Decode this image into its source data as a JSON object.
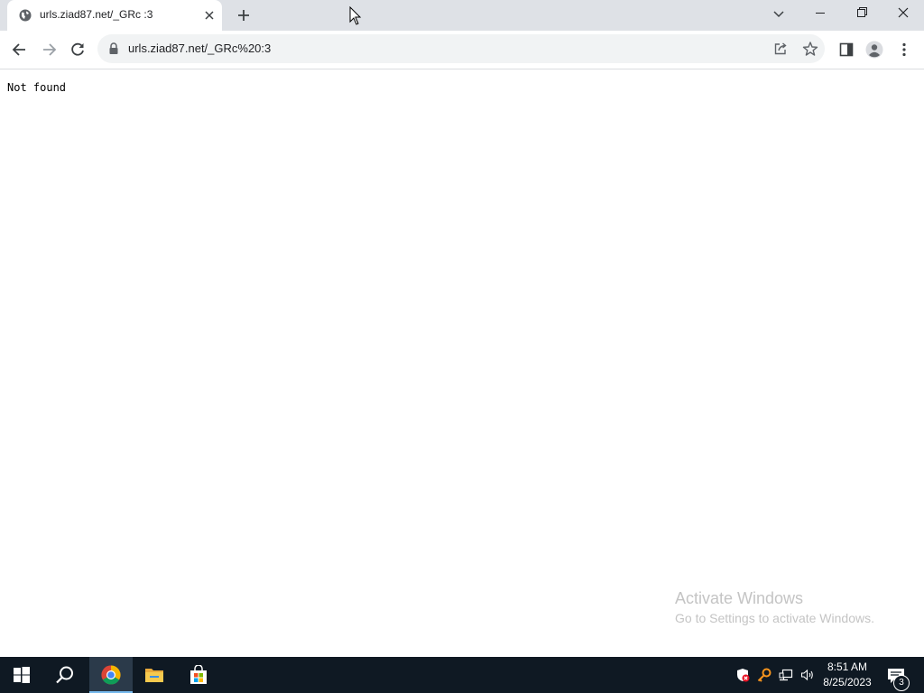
{
  "browser": {
    "tab": {
      "title": "urls.ziad87.net/_GRc :3",
      "favicon": "globe-icon"
    },
    "address_bar": {
      "url": "urls.ziad87.net/_GRc%20:3"
    },
    "icons": {
      "back": "back-arrow-icon",
      "forward": "forward-arrow-icon",
      "reload": "reload-icon",
      "share": "share-icon",
      "bookmark": "star-icon",
      "side_panel": "side-panel-icon",
      "profile": "profile-icon",
      "menu": "kebab-menu-icon"
    }
  },
  "page": {
    "body_text": "Not found"
  },
  "watermark": {
    "title": "Activate Windows",
    "subtitle": "Go to Settings to activate Windows."
  },
  "taskbar": {
    "apps": [
      "start",
      "search",
      "chrome",
      "file-explorer",
      "microsoft-store"
    ],
    "clock": {
      "time": "8:51 AM",
      "date": "8/25/2023"
    },
    "notification_count": "3"
  },
  "colors": {
    "tabstrip": "#dee1e6",
    "omnibox": "#f1f3f4",
    "taskbar": "#0f1923",
    "accent": "#76b9ed"
  }
}
